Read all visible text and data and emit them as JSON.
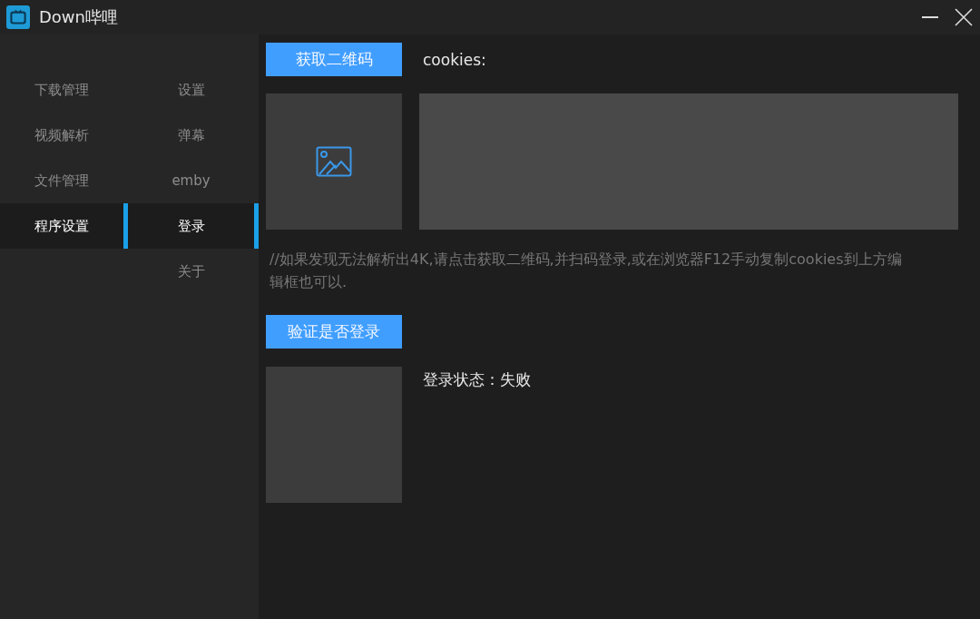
{
  "window": {
    "title": "Down哔哩"
  },
  "nav": [
    {
      "label": "下载管理",
      "selected": false
    },
    {
      "label": "视频解析",
      "selected": false
    },
    {
      "label": "文件管理",
      "selected": false
    },
    {
      "label": "程序设置",
      "selected": true
    }
  ],
  "subnav": [
    {
      "label": "设置",
      "selected": false
    },
    {
      "label": "弹幕",
      "selected": false
    },
    {
      "label": "emby",
      "selected": false
    },
    {
      "label": "登录",
      "selected": true
    },
    {
      "label": "关于",
      "selected": false
    }
  ],
  "get_qr_button": "获取二维码",
  "cookies_label": "cookies:",
  "note": "//如果发现无法解析出4K,请点击获取二维码,并扫码登录,或在浏览器F12手动复制cookies到上方编辑框也可以.",
  "verify_button": "验证是否登录",
  "login_status": "登录状态：失败"
}
